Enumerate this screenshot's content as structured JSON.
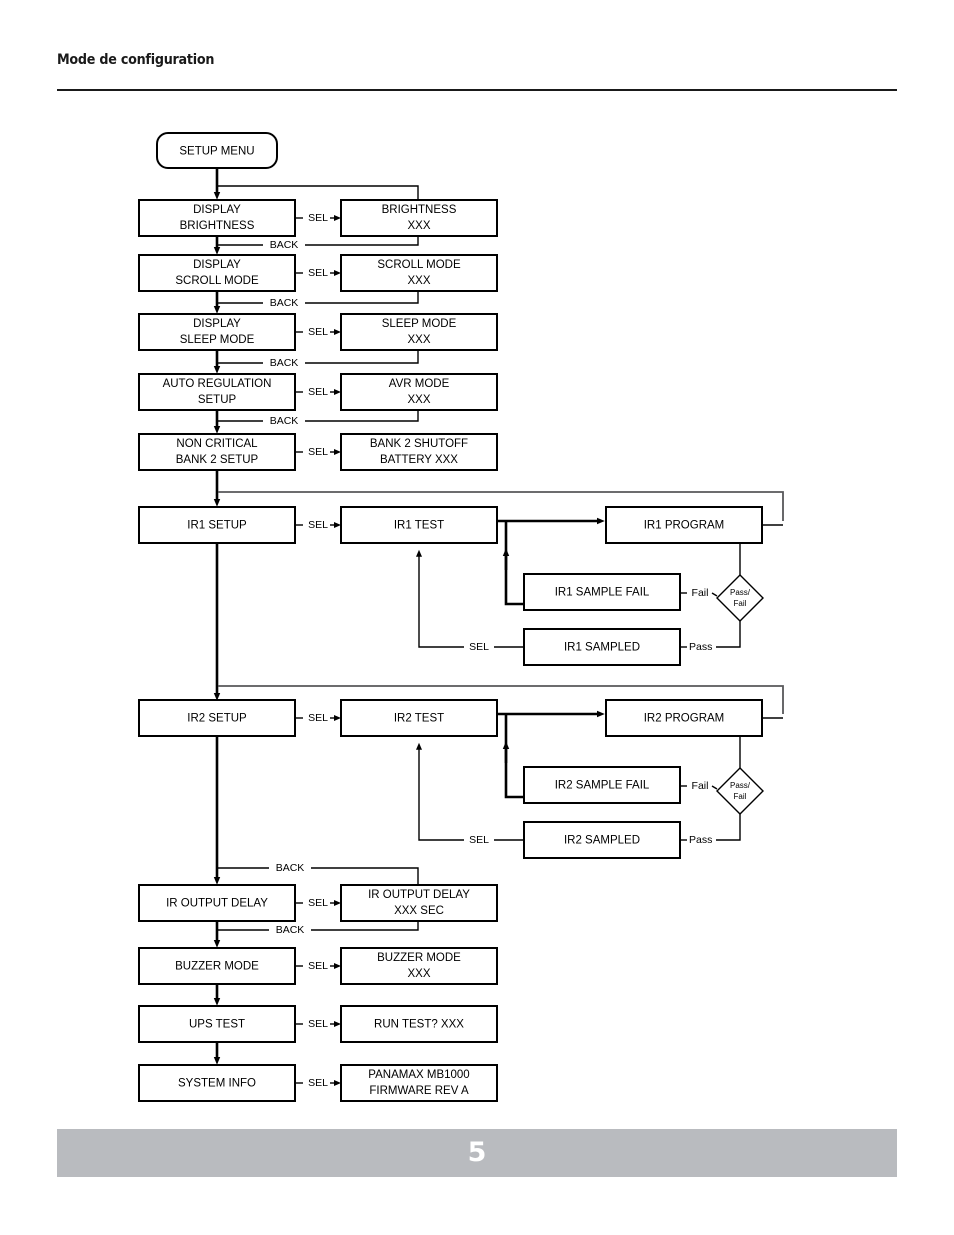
{
  "header": {
    "title": "Mode de configuration"
  },
  "footer": {
    "page_number": "5"
  },
  "diagram": {
    "type": "flowchart",
    "title": "Setup menu navigation flowchart",
    "nodes": {
      "setup_menu": "SETUP MENU",
      "display_brightness": "DISPLAY\nBRIGHTNESS",
      "display_brightness_l1": "DISPLAY",
      "display_brightness_l2": "BRIGHTNESS",
      "brightness_xxx_l1": "BRIGHTNESS",
      "brightness_xxx_l2": "XXX",
      "display_scroll_l1": "DISPLAY",
      "display_scroll_l2": "SCROLL MODE",
      "scroll_mode_l1": "SCROLL MODE",
      "scroll_mode_l2": "XXX",
      "display_sleep_l1": "DISPLAY",
      "display_sleep_l2": "SLEEP MODE",
      "sleep_mode_l1": "SLEEP MODE",
      "sleep_mode_l2": "XXX",
      "auto_reg_l1": "AUTO REGULATION",
      "auto_reg_l2": "SETUP",
      "avr_mode_l1": "AVR MODE",
      "avr_mode_l2": "XXX",
      "non_critical_l1": "NON CRITICAL",
      "non_critical_l2": "BANK 2 SETUP",
      "bank2_shutoff_l1": "BANK 2 SHUTOFF",
      "bank2_shutoff_l2": "BATTERY XXX",
      "ir1_setup": "IR1 SETUP",
      "ir1_test": "IR1 TEST",
      "ir1_program": "IR1 PROGRAM",
      "ir1_sample_fail": "IR1 SAMPLE FAIL",
      "ir1_sampled": "IR1 SAMPLED",
      "ir2_setup": "IR2 SETUP",
      "ir2_test": "IR2 TEST",
      "ir2_program": "IR2 PROGRAM",
      "ir2_sample_fail": "IR2 SAMPLE FAIL",
      "ir2_sampled": "IR2 SAMPLED",
      "ir_output_delay": "IR OUTPUT DELAY",
      "ir_output_delay_v_l1": "IR OUTPUT DELAY",
      "ir_output_delay_v_l2": "XXX SEC",
      "buzzer_mode": "BUZZER MODE",
      "buzzer_mode_v_l1": "BUZZER MODE",
      "buzzer_mode_v_l2": "XXX",
      "ups_test": "UPS TEST",
      "run_test": "RUN TEST? XXX",
      "system_info": "SYSTEM INFO",
      "firmware_l1": "PANAMAX MB1000",
      "firmware_l2": "FIRMWARE REV A",
      "decision_l1": "Pass/",
      "decision_l2": "Fail"
    },
    "edge_labels": {
      "sel": "SEL",
      "back": "BACK",
      "pass": "Pass",
      "fail": "Fail"
    },
    "colors": {
      "stroke": "#000000",
      "gray_line": "#58585a",
      "footer_bar": "#b9bbbf",
      "background": "#ffffff"
    }
  }
}
